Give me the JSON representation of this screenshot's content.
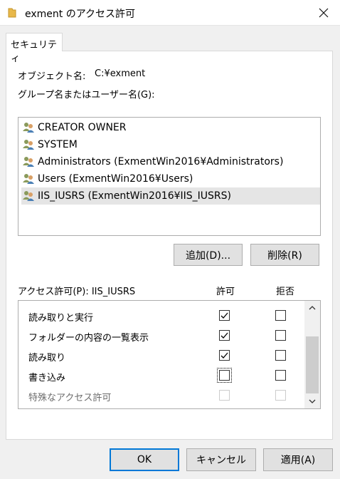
{
  "window": {
    "title": "exment のアクセス許可",
    "close_icon": "close-icon"
  },
  "tabs": [
    {
      "label": "セキュリティ"
    }
  ],
  "object": {
    "label": "オブジェクト名:",
    "value": "C:¥exment"
  },
  "groups_label": "グループ名またはユーザー名(G):",
  "principals": [
    {
      "name": "CREATOR OWNER",
      "selected": false
    },
    {
      "name": "SYSTEM",
      "selected": false
    },
    {
      "name": "Administrators (ExmentWin2016¥Administrators)",
      "selected": false
    },
    {
      "name": "Users (ExmentWin2016¥Users)",
      "selected": false
    },
    {
      "name": "IIS_IUSRS (ExmentWin2016¥IIS_IUSRS)",
      "selected": true
    }
  ],
  "buttons": {
    "add": "追加(D)...",
    "remove": "削除(R)",
    "ok": "OK",
    "cancel": "キャンセル",
    "apply": "適用(A)"
  },
  "permissions": {
    "header": "アクセス許可(P): IIS_IUSRS",
    "allow_header": "許可",
    "deny_header": "拒否",
    "rows": [
      {
        "name": "読み取りと実行",
        "allow": true,
        "deny": false,
        "disabled": false
      },
      {
        "name": "フォルダーの内容の一覧表示",
        "allow": true,
        "deny": false,
        "disabled": false
      },
      {
        "name": "読み取り",
        "allow": true,
        "deny": false,
        "disabled": false
      },
      {
        "name": "書き込み",
        "allow": false,
        "deny": false,
        "disabled": false,
        "focused": true
      },
      {
        "name": "特殊なアクセス許可",
        "allow": false,
        "deny": false,
        "disabled": true
      }
    ]
  }
}
